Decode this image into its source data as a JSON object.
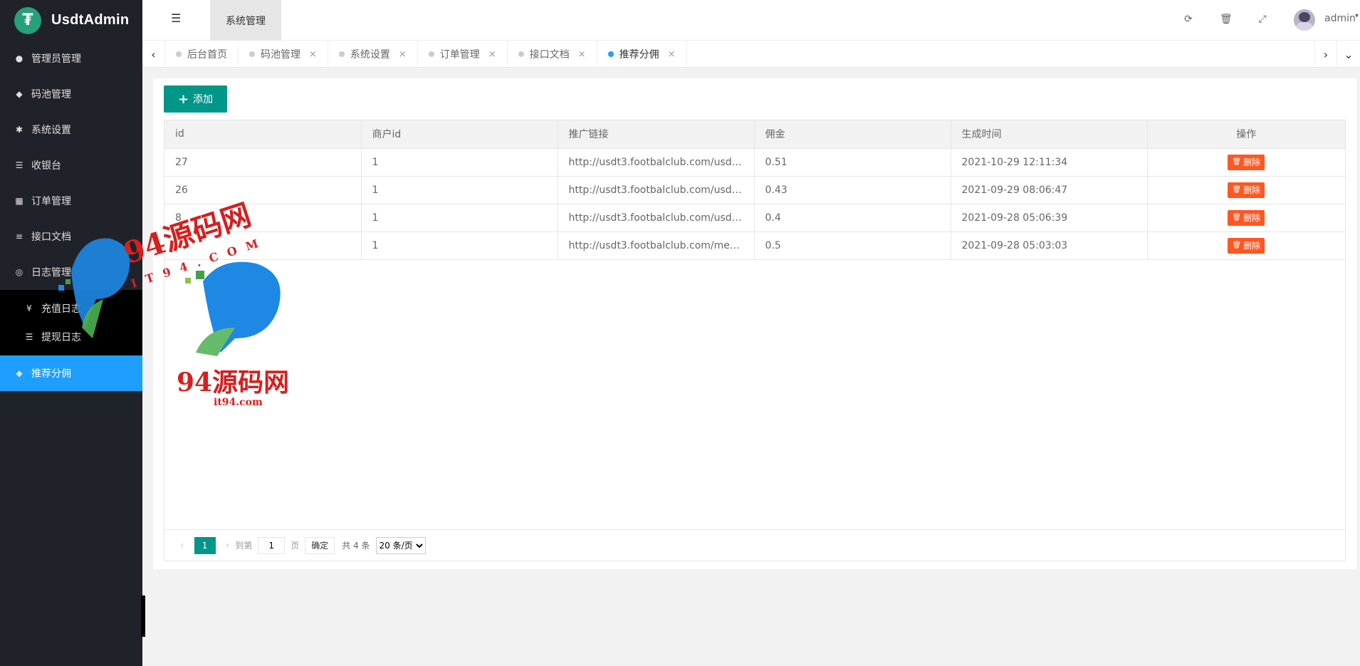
{
  "app": {
    "title": "UsdtAdmin",
    "logo_glyph": "₮",
    "brand_color": "#26a17b"
  },
  "sidebar": {
    "items": [
      {
        "label": "管理员管理",
        "icon": "user-icon"
      },
      {
        "label": "码池管理",
        "icon": "android-icon"
      },
      {
        "label": "系统设置",
        "icon": "gear-icon"
      },
      {
        "label": "收银台",
        "icon": "list-icon"
      },
      {
        "label": "订单管理",
        "icon": "calculator-icon"
      },
      {
        "label": "接口文档",
        "icon": "align-icon"
      },
      {
        "label": "日志管理",
        "icon": "log-icon"
      }
    ],
    "subitems": [
      {
        "label": "充值日志",
        "icon": "yen-icon"
      },
      {
        "label": "提现日志",
        "icon": "list-icon"
      }
    ],
    "active_item": {
      "label": "推荐分佣",
      "icon": "android-icon"
    },
    "active_color": "#1e9fff"
  },
  "header": {
    "tab_label": "系统管理",
    "username": "admin"
  },
  "tabs": [
    {
      "label": "后台首页",
      "closable": false
    },
    {
      "label": "码池管理",
      "closable": true
    },
    {
      "label": "系统设置",
      "closable": true
    },
    {
      "label": "订单管理",
      "closable": true
    },
    {
      "label": "接口文档",
      "closable": true
    },
    {
      "label": "推荐分佣",
      "closable": true,
      "active": true
    }
  ],
  "toolbar": {
    "add_label": "添加"
  },
  "table": {
    "columns": [
      "id",
      "商户id",
      "推广链接",
      "佣金",
      "生成时间",
      "操作"
    ],
    "delete_label": "删除",
    "rows": [
      {
        "id": "27",
        "merchant_id": "1",
        "link": "http://usdt3.footbalclub.com/usdtmer...",
        "commission": "0.51",
        "created": "2021-10-29 12:11:34"
      },
      {
        "id": "26",
        "merchant_id": "1",
        "link": "http://usdt3.footbalclub.com/usdtmer...",
        "commission": "0.43",
        "created": "2021-09-29 08:06:47"
      },
      {
        "id": "8",
        "merchant_id": "1",
        "link": "http://usdt3.footbalclub.com/usdtmer...",
        "commission": "0.4",
        "created": "2021-09-28 05:06:39"
      },
      {
        "id": "",
        "merchant_id": "1",
        "link": "http://usdt3.footbalclub.com/merchan...",
        "commission": "0.5",
        "created": "2021-09-28 05:03:03"
      }
    ]
  },
  "pager": {
    "current_page": "1",
    "goto_label": "到第",
    "goto_value": "1",
    "page_unit": "页",
    "confirm_label": "确定",
    "total_label": "共 4 条",
    "page_size_option": "20 条/页"
  },
  "watermark": {
    "text1": "94源码网",
    "text2": "I T 9 4 . C O M",
    "text3": "94源码网",
    "text4": "it94.com"
  },
  "colors": {
    "primary": "#009688",
    "danger": "#ff5722",
    "sidebar_bg": "#20222a"
  }
}
